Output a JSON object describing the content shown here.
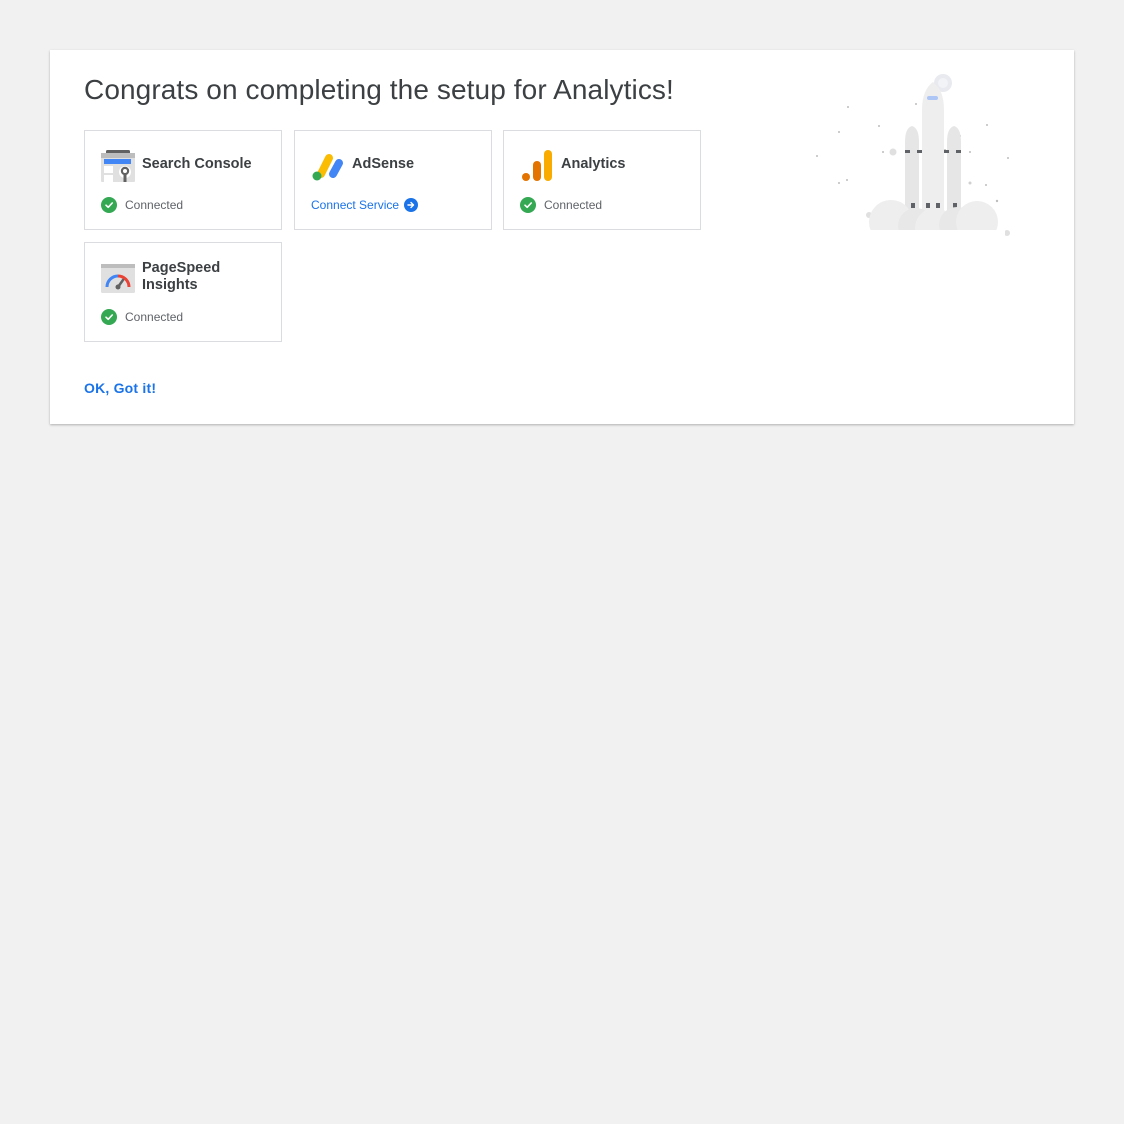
{
  "header": {
    "title": "Congrats on completing the setup for Analytics!"
  },
  "services": [
    {
      "name": "Search Console",
      "icon": "search-console-icon",
      "status": "Connected",
      "connected": true
    },
    {
      "name": "AdSense",
      "icon": "adsense-icon",
      "action": "Connect Service",
      "connected": false
    },
    {
      "name": "Analytics",
      "icon": "analytics-icon",
      "status": "Connected",
      "connected": true
    },
    {
      "name": "PageSpeed Insights",
      "icon": "pagespeed-insights-icon",
      "status": "Connected",
      "connected": true
    }
  ],
  "footer": {
    "ok_label": "OK, Got it!"
  },
  "colors": {
    "accent": "#1a73e8",
    "success": "#34a853",
    "background": "#f1f1f1",
    "card": "#ffffff",
    "text": "#3c4043"
  }
}
